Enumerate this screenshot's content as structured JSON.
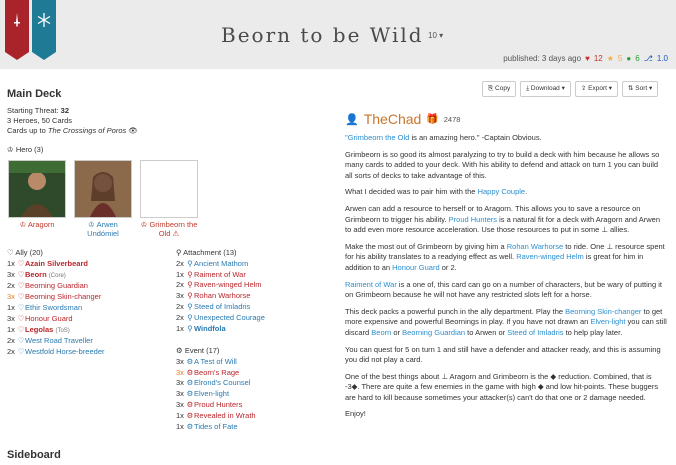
{
  "header": {
    "title": "Beorn to be Wild",
    "version": "10",
    "published": "published: 3 days ago",
    "likes": "12",
    "favorites": "5",
    "comments": "6",
    "versions": "1.0"
  },
  "deck": {
    "title": "Main Deck",
    "threat_label": "Starting Threat:",
    "threat_value": "32",
    "counts": "3 Heroes, 50 Cards",
    "upto_prefix": "Cards up to",
    "upto_pack": "The Crossings of Poros",
    "hero_head": "Hero (3)",
    "heroes": [
      {
        "name": "Aragorn"
      },
      {
        "name": "Arwen Undómiel"
      },
      {
        "name": "Grimbeorn the Old"
      }
    ],
    "ally_head": "Ally (20)",
    "allies": [
      {
        "count": "1x",
        "name": "Azain Silverbeard",
        "extra": ""
      },
      {
        "count": "3x",
        "name": "Beorn",
        "extra": "(Core)"
      },
      {
        "count": "2x",
        "name": "Beorning Guardian",
        "extra": ""
      },
      {
        "count": "3x",
        "name": "Beorning Skin-changer",
        "extra": ""
      },
      {
        "count": "1x",
        "name": "Ethir Swordsman",
        "extra": ""
      },
      {
        "count": "3x",
        "name": "Honour Guard",
        "extra": ""
      },
      {
        "count": "1x",
        "name": "Legolas",
        "extra": "(ToS)"
      },
      {
        "count": "2x",
        "name": "West Road Traveller",
        "extra": ""
      },
      {
        "count": "2x",
        "name": "Westfold Horse-breeder",
        "extra": ""
      }
    ],
    "attachment_head": "Attachment (13)",
    "attachments": [
      {
        "count": "2x",
        "name": "Ancient Mathom"
      },
      {
        "count": "1x",
        "name": "Raiment of War"
      },
      {
        "count": "2x",
        "name": "Raven-winged Helm"
      },
      {
        "count": "3x",
        "name": "Rohan Warhorse"
      },
      {
        "count": "2x",
        "name": "Steed of Imladris"
      },
      {
        "count": "2x",
        "name": "Unexpected Courage"
      },
      {
        "count": "1x",
        "name": "Windfola"
      }
    ],
    "event_head": "Event (17)",
    "events": [
      {
        "count": "3x",
        "name": "A Test of Will"
      },
      {
        "count": "3x",
        "name": "Beorn's Rage"
      },
      {
        "count": "3x",
        "name": "Elrond's Counsel"
      },
      {
        "count": "3x",
        "name": "Elven-light"
      },
      {
        "count": "3x",
        "name": "Proud Hunters"
      },
      {
        "count": "1x",
        "name": "Revealed in Wrath"
      },
      {
        "count": "1x",
        "name": "Tides of Fate"
      }
    ],
    "sideboard": "Sideboard"
  },
  "toolbar": {
    "copy": "Copy",
    "download": "Download",
    "export": "Export",
    "sort": "Sort"
  },
  "author": {
    "name": "TheChad",
    "points": "2478"
  },
  "description": {
    "p1": {
      "link": "\"Grimbeorn the Old",
      "rest": " is an amazing hero.\" -Captain Obvious."
    },
    "p2": "Grimbeorn is so good its almost paralyzing to try to build a deck with him because he allows so many cards to added to your deck. With his ability to defend and attack on turn 1 you can build all sorts of decks to take advantage of this.",
    "p3": {
      "pre": "What I decided was to pair him with the ",
      "link": "Happy Couple",
      "post": "."
    },
    "p4": {
      "pre": "Arwen can add a resource to herself or to Aragorn. This allows you to save a resource on Grimbeorn to trigger his ability. ",
      "link": "Proud Hunters",
      "post": " is a natural fit for a deck with Aragorn and Arwen to add even more resource acceleration. Use those resources to put in some ⊥ allies."
    },
    "p5": {
      "pre": "Make the most out of Grimbeorn by giving him a ",
      "link1": "Rohan Warhorse",
      "mid1": " to ride. One ⊥ resource spent for his ability translates to a readying effect as well. ",
      "link2": "Raven-winged Helm",
      "mid2": " is great for him in addition to an ",
      "link3": "Honour Guard",
      "post": " or 2."
    },
    "p6": {
      "link": "Raiment of War",
      "post": " is a one of, this card can go on a number of characters, but be wary of putting it on Grimbeorn because he will not have any restricted slots left for a horse."
    },
    "p7": {
      "pre": "This deck packs a powerful punch in the ally department. Play the ",
      "link1": "Beorning Skin-changer",
      "mid1": " to get more expensive and powerful Beornings in play. If you have not drawn an ",
      "link2": "Elven-light",
      "mid2": " you can still discard ",
      "link3": "Beorn",
      "mid3": " or ",
      "link4": "Beorning Guardian",
      "mid4": " to Arwen or ",
      "link5": "Steed of Imladris",
      "post": " to help play later."
    },
    "p8": "You can quest for 5 on turn 1 and still have a defender and attacker ready, and this is assuming you did not play a card.",
    "p9": "One of the best things about ⊥ Aragorn and Grimbeorn is the ◆ reduction. Combined, that is -3◆. There are quite a few enemies in the game with high ◆ and low hit-points. These buggers are hard to kill because sometimes your attacker(s) can't do that one or 2 damage needed.",
    "p10": "Enjoy!"
  }
}
